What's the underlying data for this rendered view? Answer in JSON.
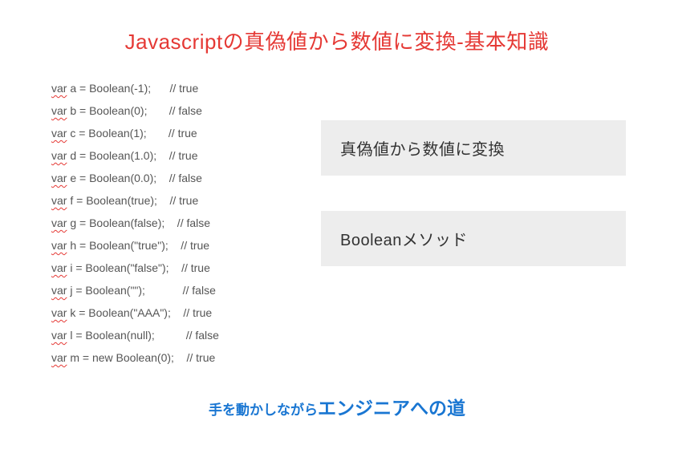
{
  "title": "Javascriptの真偽値から数値に変換-基本知識",
  "code": {
    "kw": "var",
    "lines": [
      {
        "rest": " a = Boolean(-1);      // true"
      },
      {
        "rest": " b = Boolean(0);       // false"
      },
      {
        "rest": " c = Boolean(1);       // true"
      },
      {
        "rest": " d = Boolean(1.0);    // true"
      },
      {
        "rest": " e = Boolean(0.0);    // false"
      },
      {
        "rest": " f = Boolean(true);    // true"
      },
      {
        "rest": " g = Boolean(false);    // false"
      },
      {
        "rest": " h = Boolean(\"true\");    // true"
      },
      {
        "rest": " i = Boolean(\"false\");    // true"
      },
      {
        "rest": " j = Boolean(\"\");            // false"
      },
      {
        "rest": " k = Boolean(\"AAA\");    // true"
      },
      {
        "rest": " l = Boolean(null);          // false"
      },
      {
        "rest": " m = new Boolean(0);    // true"
      }
    ]
  },
  "side": {
    "box1": "真偽値から数値に変換",
    "box2": "Booleanメソッド"
  },
  "footer": {
    "small": "手を動かしながら",
    "big": "エンジニアへの道"
  }
}
